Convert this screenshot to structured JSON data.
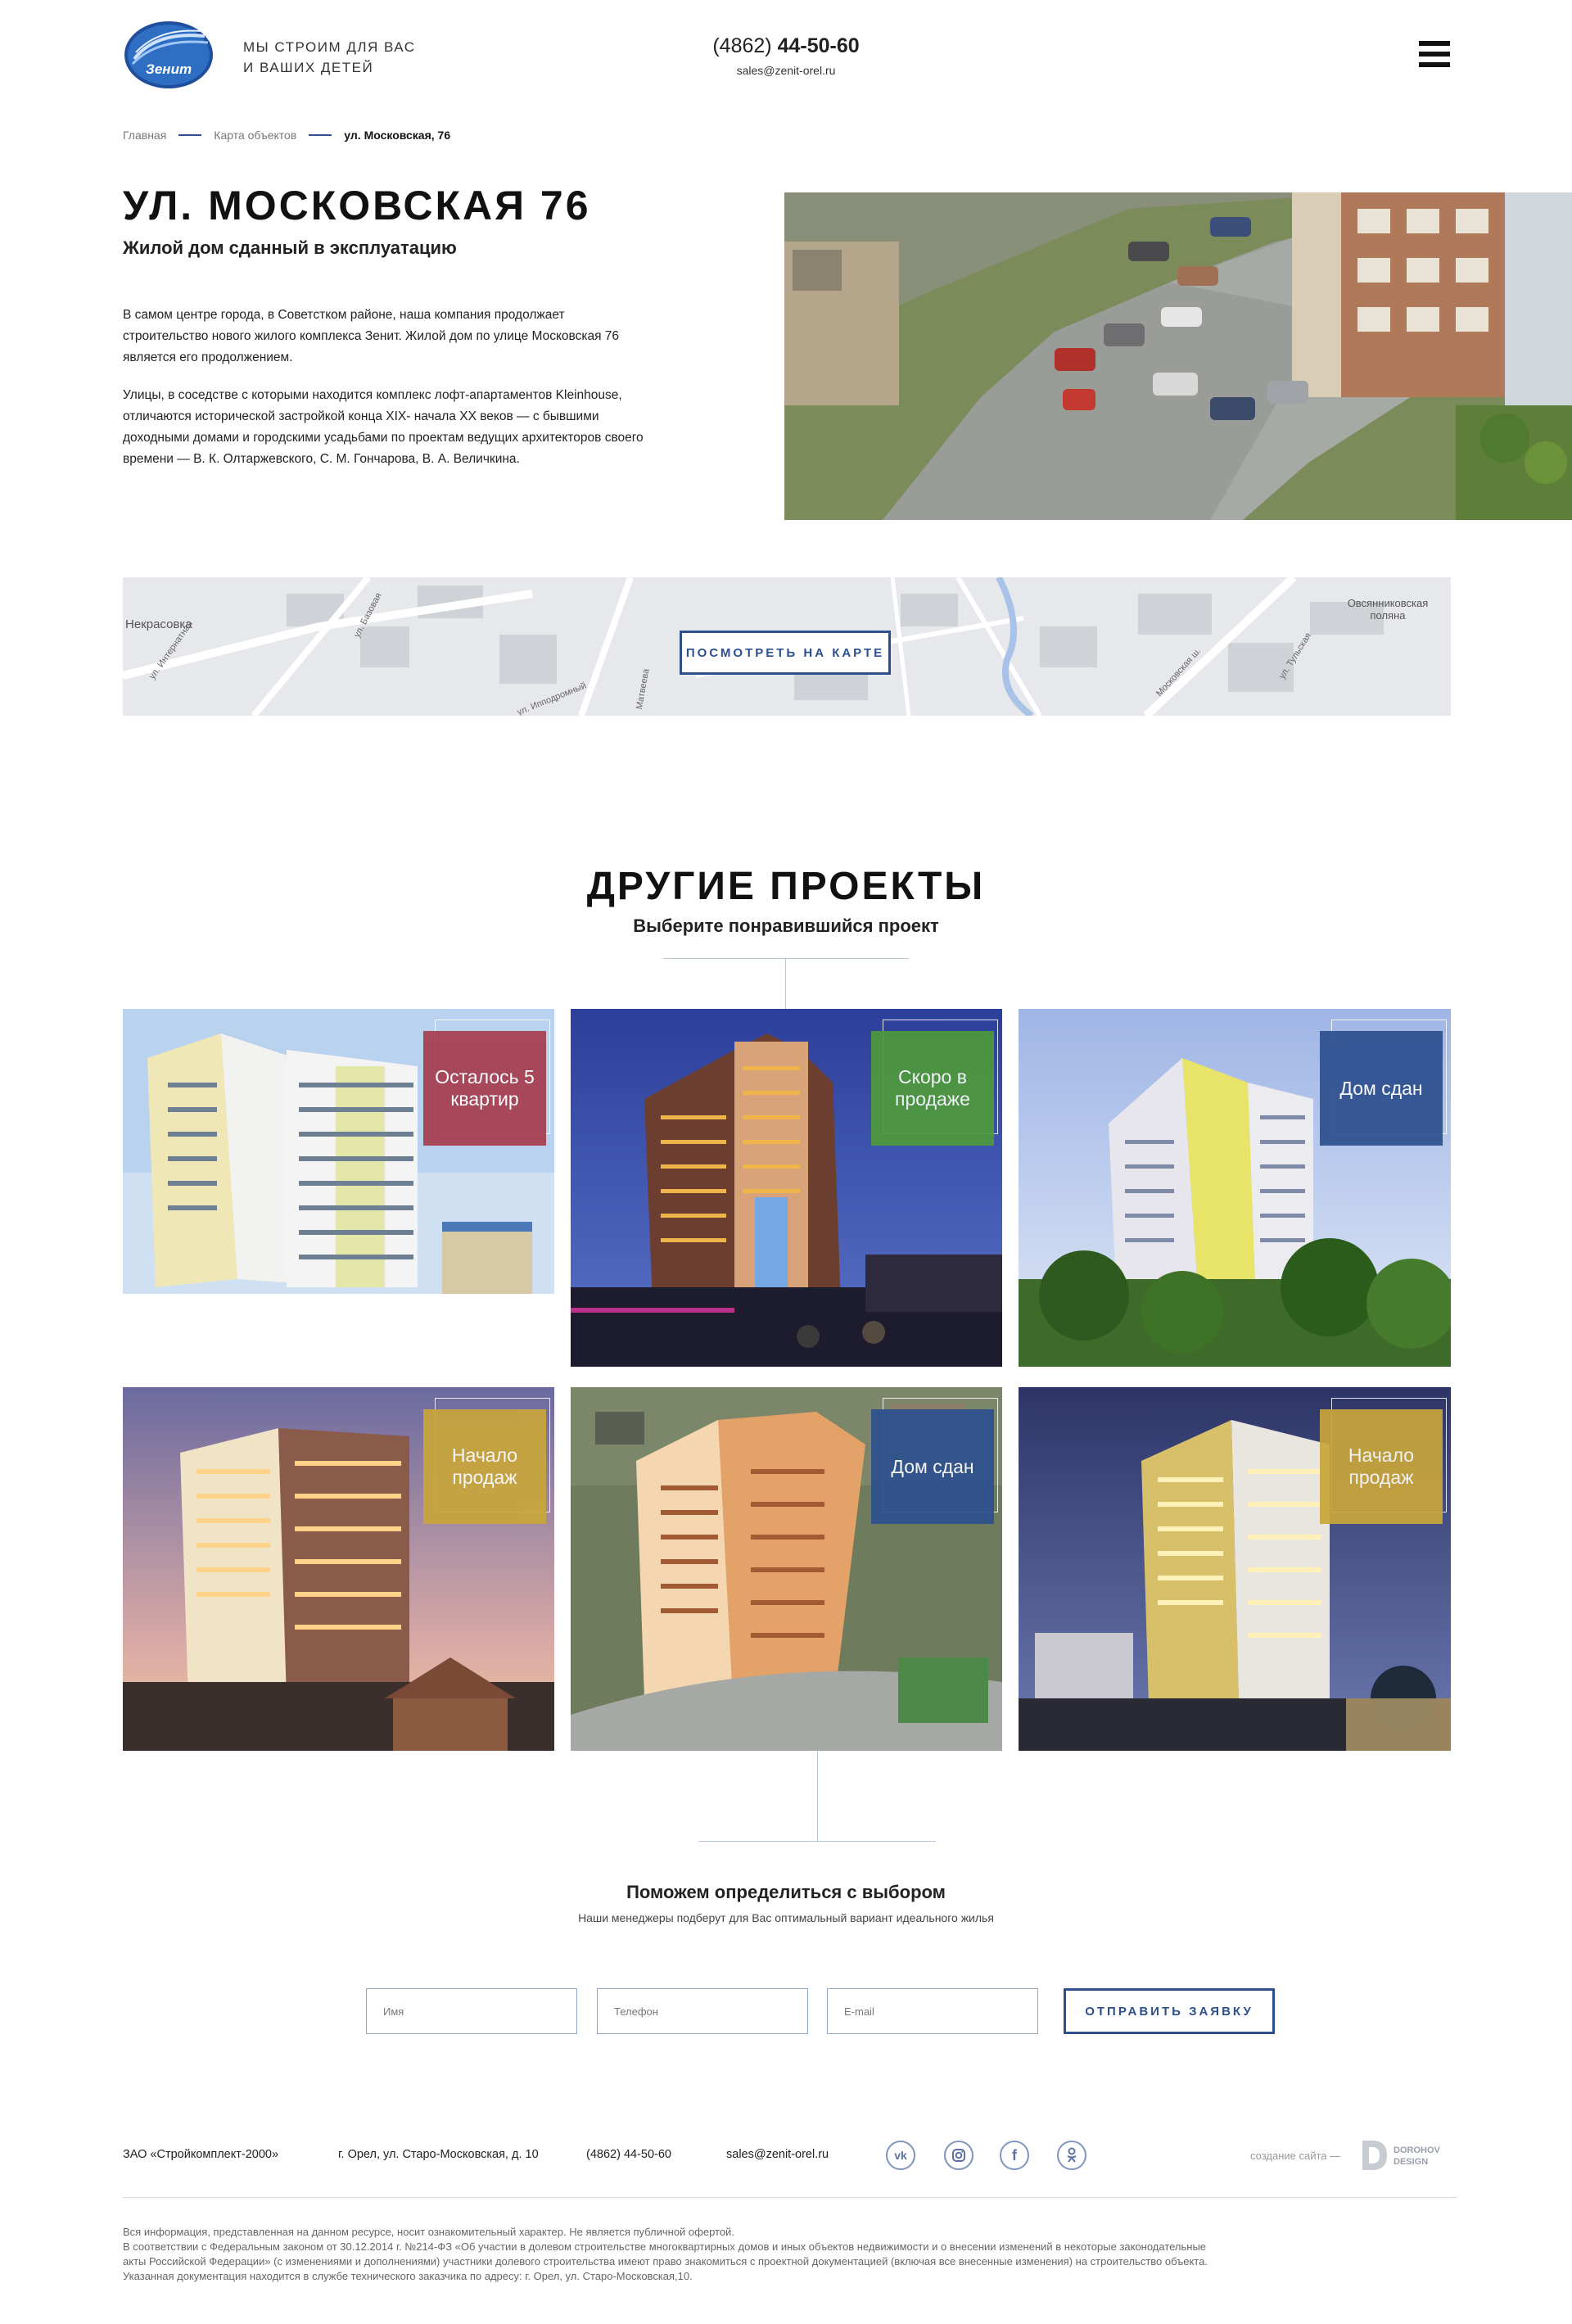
{
  "header": {
    "logo_text": "Зенит",
    "tagline_1": "Мы строим для вас",
    "tagline_2": "и ваших детей",
    "phone_code": "(4862)",
    "phone_number": "44-50-60",
    "email": "sales@zenit-orel.ru"
  },
  "breadcrumbs": {
    "home": "Главная",
    "map": "Карта объектов",
    "current": "ул. Московская, 76"
  },
  "hero": {
    "title": "УЛ. МОСКОВСКАЯ 76",
    "subtitle": "Жилой дом сданный в эксплуатацию",
    "paragraph_1": "В самом центре города, в Советстком районе, наша компания продолжает строительство нового жилого комплекса Зенит. Жилой дом по улице Московская 76 является его продолжением.",
    "paragraph_2": "Улицы, в соседстве с которыми находится комплекс лофт-апартаментов Kleinhouse, отличаются исторической застройкой конца XIX- начала XX веков — с бывшими доходными домами и городскими усадьбами по проектам ведущих архитекторов своего времени —      В. К. Олтаржевского, С. М. Гончарова, В. А. Величкина."
  },
  "map": {
    "button_label": "ПОСМОТРЕТЬ НА КАРТЕ",
    "labels": [
      "Некрасовка",
      "Овсянниковская поляна",
      "ул. Интернатная",
      "ул. Базовая",
      "ул. Ипподромный",
      "Матвеева",
      "Московская ш.",
      "ул. Тульская"
    ]
  },
  "projects": {
    "title": "ДРУГИЕ ПРОЕКТЫ",
    "subtitle": "Выберите понравившийся проект",
    "items": [
      {
        "badge": "Осталось 5 квартир",
        "color": "#a63d4e"
      },
      {
        "badge": "Скоро в продаже",
        "color": "#4e9a3b"
      },
      {
        "badge": "Дом сдан",
        "color": "#2d4f8e"
      },
      {
        "badge": "Начало продаж",
        "color": "#c9a63a"
      },
      {
        "badge": "Дом сдан",
        "color": "#2d4f8e"
      },
      {
        "badge": "Начало продаж",
        "color": "#c9a63a"
      }
    ]
  },
  "help": {
    "title": "Поможем определиться с выбором",
    "subtitle": "Наши менеджеры подберут для Вас оптимальный вариант идеального жилья",
    "name_placeholder": "Имя",
    "phone_placeholder": "Телефон",
    "email_placeholder": "E-mail",
    "submit_label": "ОТПРАВИТЬ ЗАЯВКУ"
  },
  "footer": {
    "company": "ЗАО «Стройкомплект-2000»",
    "address": "г. Орел, ул. Старо-Московская, д. 10",
    "phone": "(4862) 44-50-60",
    "email": "sales@zenit-orel.ru",
    "made_by": "создание сайта —",
    "studio_line_1": "DOROHOV",
    "studio_line_2": "DESIGN",
    "legal_1": "Вся информация, представленная на данном ресурсе, носит ознакомительный характер. Не является публичной офертой.",
    "legal_2": "В соответствии с Федеральным законом от 30.12.2014 г. №214-ФЗ «Об участии в долевом строительстве многоквартирных домов и иных объектов недвижимости и о внесении изменений в некоторые законодательные акты Российской Федерации» (с изменениями и дополнениями) участники долевого строительства имеют право знакомиться с проектной документацией (включая все внесенные изменения) на строительство объекта.",
    "legal_3": "Указанная документация находится в службе технического заказчика по адресу: г. Орел, ул. Старо-Московская,10."
  }
}
